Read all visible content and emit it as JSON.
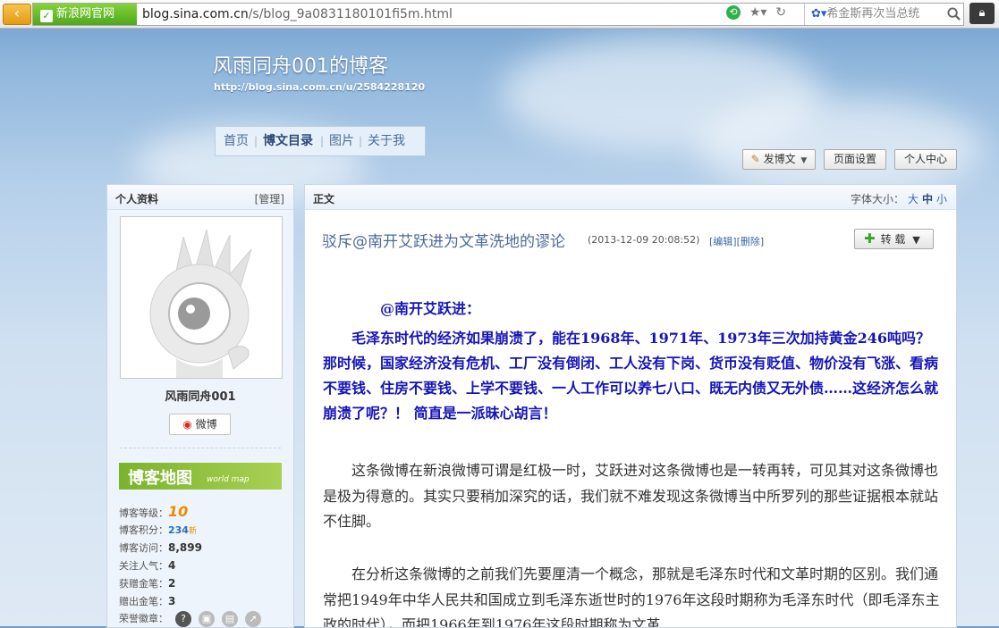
{
  "browser": {
    "site_name": "新浪网官网",
    "url_host": "blog.sina.com.cn",
    "url_path": "/s/blog_9a0831180101fi5m.html",
    "search_text": "希金斯再次当总统"
  },
  "blog": {
    "title": "风雨同舟001的博客",
    "url": "http://blog.sina.com.cn/u/2584228120",
    "nav": [
      {
        "label": "首页"
      },
      {
        "label": "博文目录"
      },
      {
        "label": "图片"
      },
      {
        "label": "关于我"
      }
    ],
    "toolbar": {
      "post": "发博文",
      "page_settings": "页面设置",
      "personal_center": "个人中心"
    }
  },
  "sidebar": {
    "title": "个人资料",
    "manage": "[管理]",
    "nickname": "风雨同舟001",
    "weibo_label": "微博",
    "map_title": "博客地图",
    "map_subtitle": "world map",
    "stats": {
      "level_label": "博客等级：",
      "level_value": "10",
      "points_label": "博客积分：",
      "points_value": "234",
      "points_badge": "新",
      "visits_label": "博客访问：",
      "visits_value": "8,899",
      "popularity_label": "关注人气：",
      "popularity_value": "4",
      "gift_label": "获赠金笔：",
      "gift_value": "2",
      "given_label": "赠出金笔：",
      "given_value": "3",
      "honor_label": "荣誉徽章："
    }
  },
  "article": {
    "section": "正文",
    "font_size_label": "字体大小：",
    "font_sizes": [
      "大",
      "中",
      "小"
    ],
    "title": "驳斥@南开艾跃进为文革洗地的谬论",
    "date": "(2013-12-09 20:08:52)",
    "edit": "[编辑]",
    "delete": "[删除]",
    "repost": "转 载",
    "quote_to": "@南开艾跃进：",
    "quote_body": "毛泽东时代的经济如果崩溃了，能在1968年、1971年、1973年三次加持黄金246吨吗？那时候，国家经济没有危机、工厂没有倒闭、工人没有下岗、货币没有贬值、物价没有飞涨、看病不要钱、住房不要钱、上学不要钱、一人工作可以养七八口、既无内债又无外债……这经济怎么就崩溃了呢？！ 简直是一派昧心胡言！",
    "para1": "这条微博在新浪微博可谓是红极一时，艾跃进对这条微博也是一转再转，可见其对这条微博也是极为得意的。其实只要稍加深究的话，我们就不难发现这条微博当中所罗列的那些证据根本就站不住脚。",
    "para2": "在分析这条微博的之前我们先要厘清一个概念，那就是毛泽东时代和文革时期的区别。我们通常把1949年中华人民共和国成立到毛泽东逝世时的1976年这段时期称为毛泽东时代（即毛泽东主政的时代），而把1966年到1976年这段时期称为文革"
  }
}
